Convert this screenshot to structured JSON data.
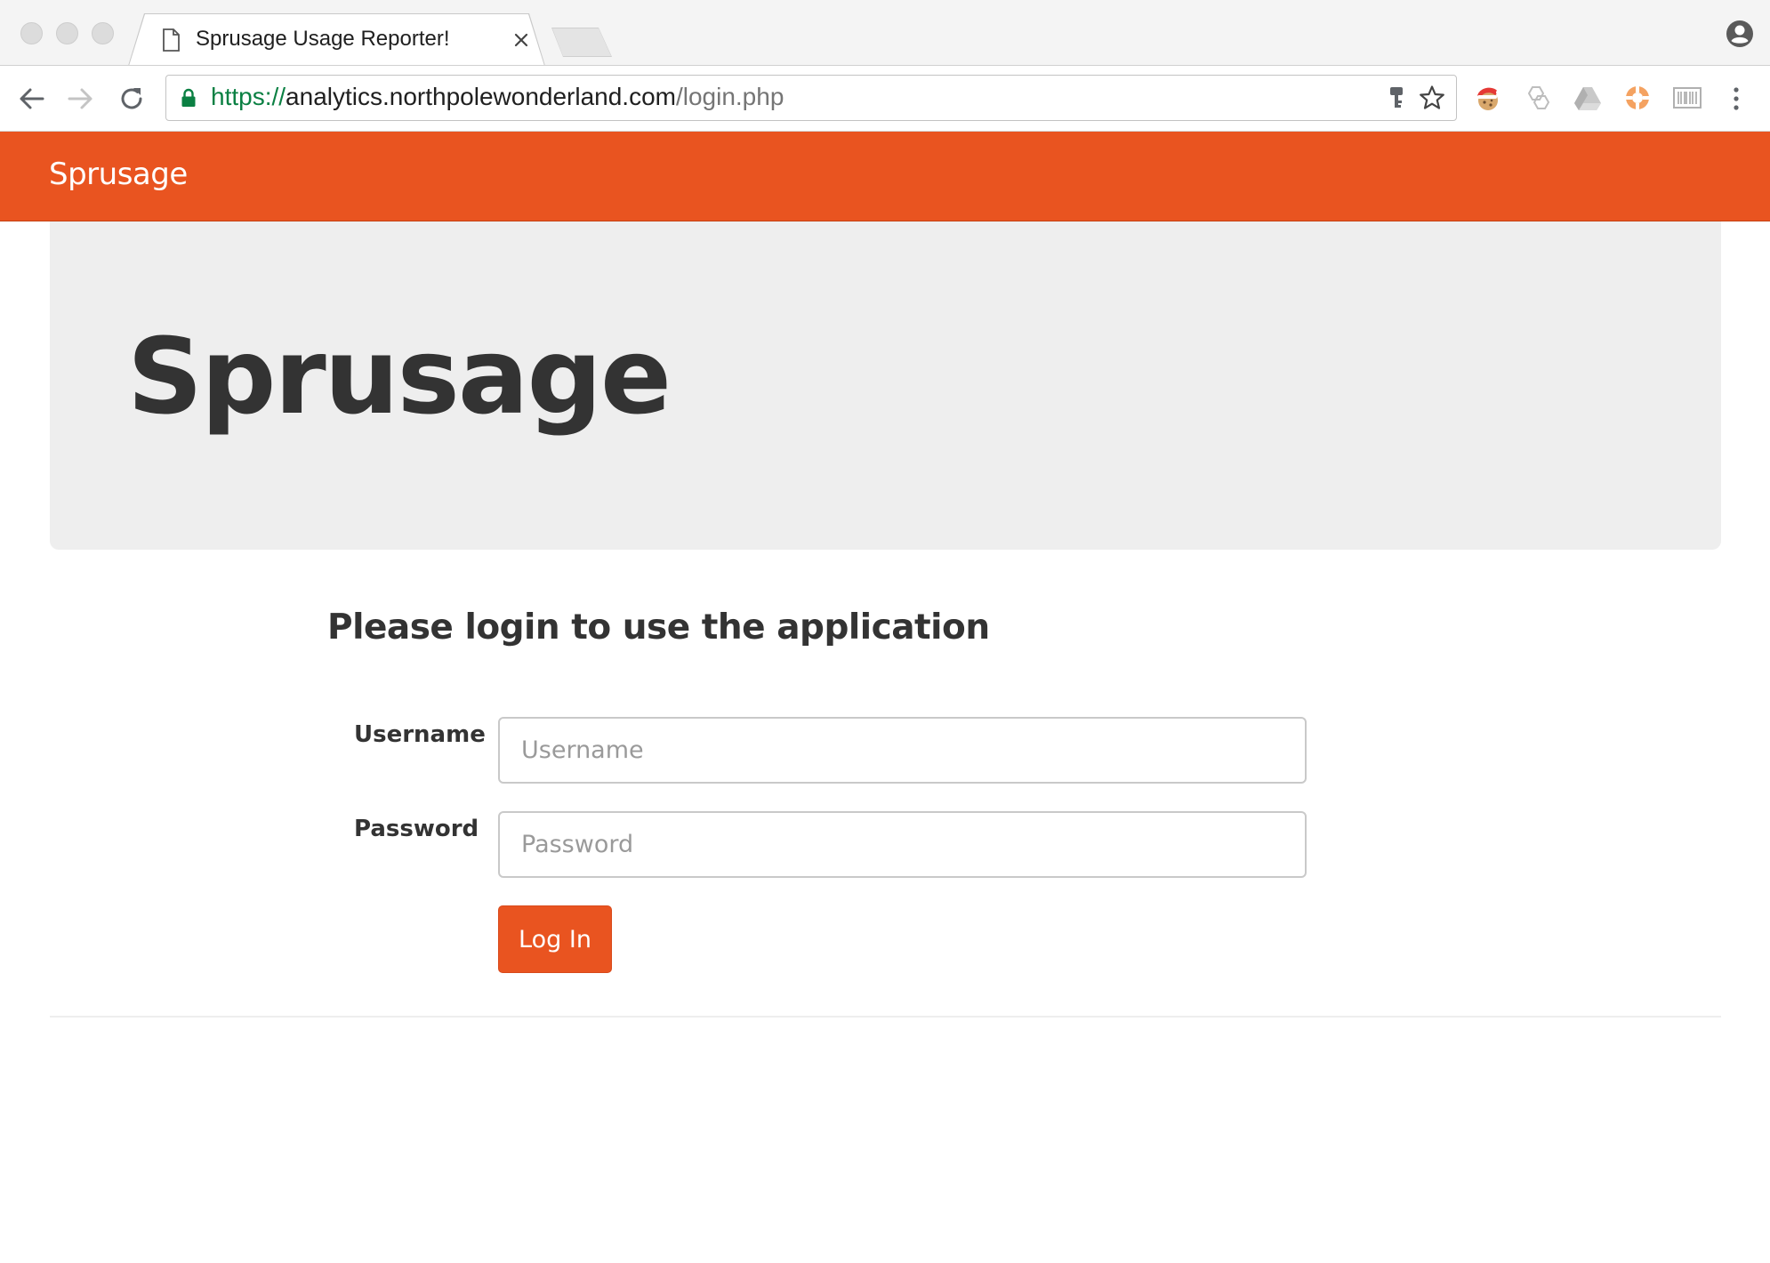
{
  "browser": {
    "tab": {
      "title": "Sprusage Usage Reporter!"
    },
    "address": {
      "scheme": "https://",
      "host": "analytics.northpolewonderland.com",
      "path": "/login.php"
    },
    "colors": {
      "secure": "#0b8043"
    },
    "extensions": [
      "santa-cookie-icon",
      "hexagon-extension-icon",
      "drive-icon",
      "lifebuoy-icon",
      "barcode-icon"
    ]
  },
  "navbar": {
    "brand": "Sprusage"
  },
  "hero": {
    "title": "Sprusage"
  },
  "login": {
    "heading": "Please login to use the application",
    "username_label": "Username",
    "username_placeholder": "Username",
    "password_label": "Password",
    "password_placeholder": "Password",
    "submit_label": "Log In"
  },
  "theme": {
    "accent": "#e95420",
    "jumbotron": "#eeeeee",
    "text": "#333333"
  }
}
